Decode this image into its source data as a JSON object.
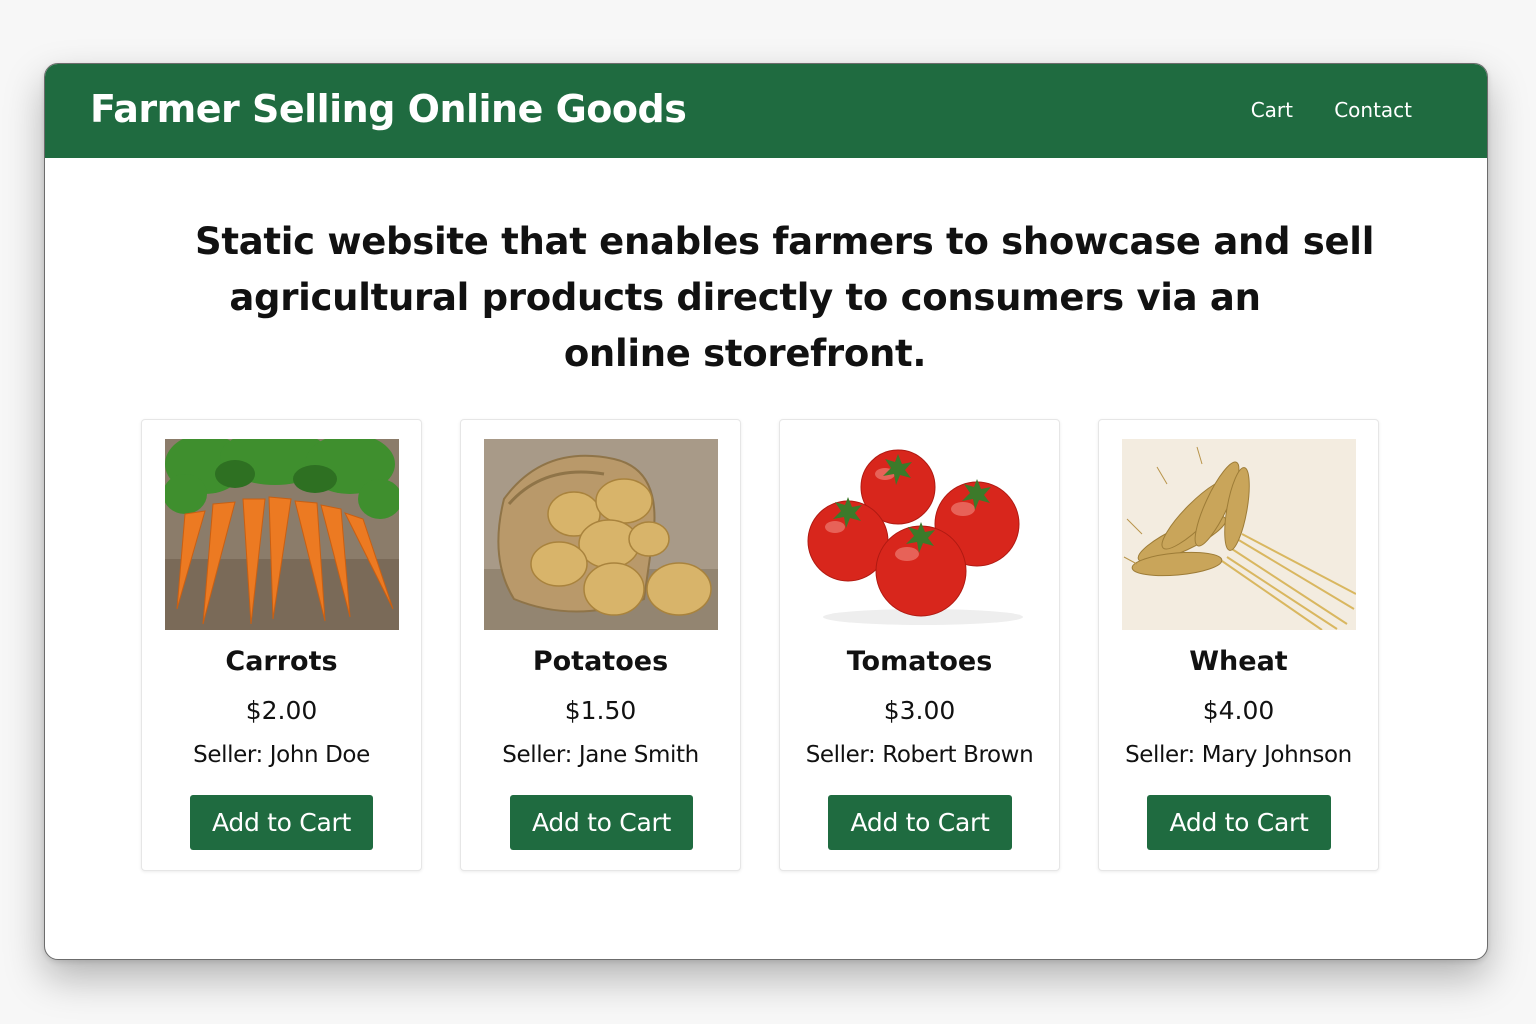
{
  "header": {
    "title": "Farmer Selling Online Goods",
    "nav": [
      {
        "label": "Cart"
      },
      {
        "label": "Contact"
      }
    ]
  },
  "hero": {
    "lines": [
      "Static website that enables farmers to showcase and sell",
      "agricultural products directly to consumers via an",
      "online storefront."
    ]
  },
  "products": [
    {
      "name": "Carrots",
      "price": "$2.00",
      "seller": "Seller: John Doe",
      "button": "Add to Cart",
      "icon": "carrots-image"
    },
    {
      "name": "Potatoes",
      "price": "$1.50",
      "seller": "Seller: Jane Smith",
      "button": "Add to Cart",
      "icon": "potatoes-image"
    },
    {
      "name": "Tomatoes",
      "price": "$3.00",
      "seller": "Seller: Robert Brown",
      "button": "Add to Cart",
      "icon": "tomatoes-image"
    },
    {
      "name": "Wheat",
      "price": "$4.00",
      "seller": "Seller: Mary Johnson",
      "button": "Add to Cart",
      "icon": "wheat-image"
    }
  ],
  "colors": {
    "brand_green": "#1f6b40",
    "text": "#111111",
    "card_border": "#e6e6e6"
  }
}
